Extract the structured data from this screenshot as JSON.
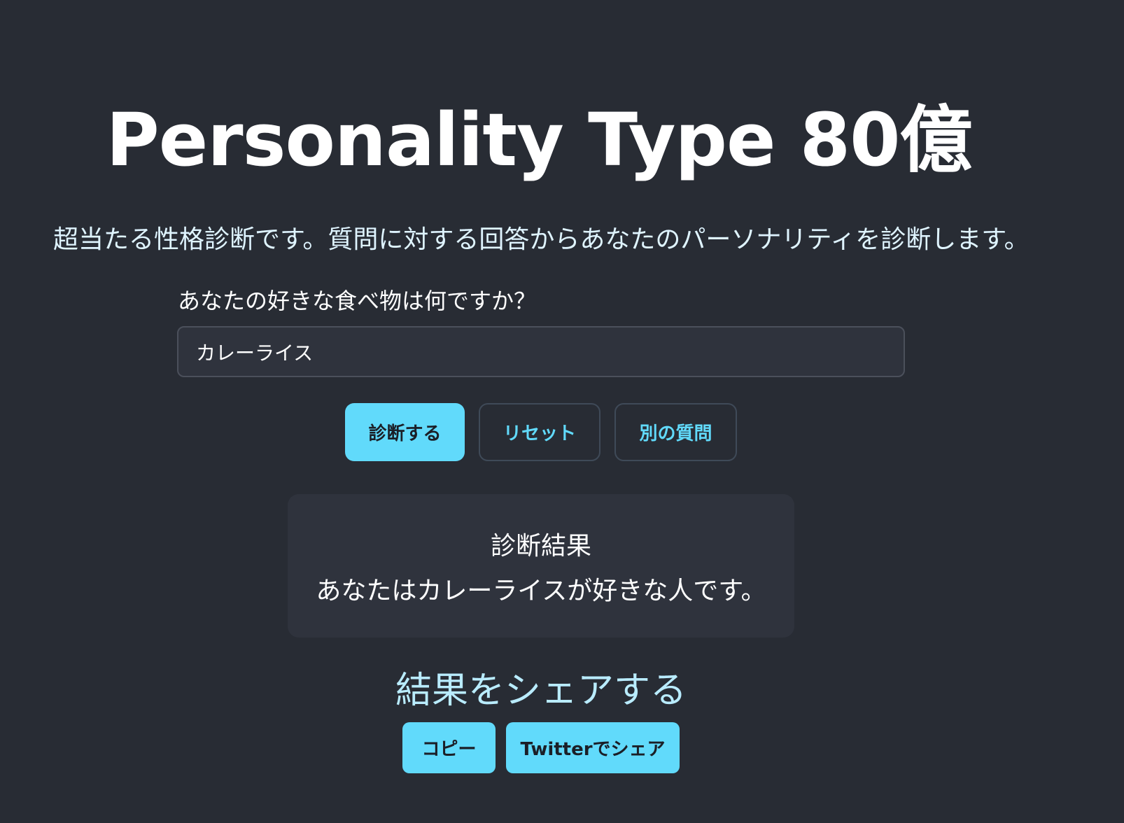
{
  "header": {
    "title": "Personality Type 80億"
  },
  "intro": {
    "description": "超当たる性格診断です。質問に対する回答からあなたのパーソナリティを診断します。"
  },
  "form": {
    "question": "あなたの好きな食べ物は何ですか？",
    "answer_value": "カレーライス",
    "diagnose_label": "診断する",
    "reset_label": "リセット",
    "other_question_label": "別の質問"
  },
  "result": {
    "heading": "診断結果",
    "text": "あなたはカレーライスが好きな人です。"
  },
  "share": {
    "heading": "結果をシェアする",
    "copy_label": "コピー",
    "twitter_label": "Twitterでシェア"
  },
  "colors": {
    "background": "#282c34",
    "accent": "#61dafb",
    "panel": "#2f333d"
  }
}
